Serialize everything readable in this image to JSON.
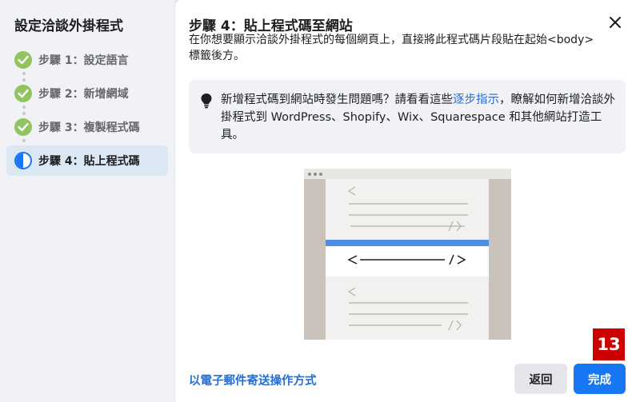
{
  "sidebar": {
    "title": "設定洽談外掛程式",
    "steps": [
      {
        "label": "步驟 1：設定語言",
        "state": "done"
      },
      {
        "label": "步驟 2：新增網域",
        "state": "done"
      },
      {
        "label": "步驟 3：複製程式碼",
        "state": "done"
      },
      {
        "label": "步驟 4：貼上程式碼",
        "state": "current"
      }
    ]
  },
  "main": {
    "title": "步驟 4：貼上程式碼至網站",
    "description": "在你想要顯示洽談外掛程式的每個網頁上，直接將此程式碼片段貼在起始<body>標籤後方。",
    "tip": {
      "icon": "lightbulb-icon",
      "text_before": "新增程式碼到網站時發生問題嗎？請看看這些",
      "link": "逐步指示",
      "text_after": "，瞭解如何新增洽談外掛程式到 WordPress、Shopify、Wix、Squarespace 和其他網站打造工具。"
    }
  },
  "footer": {
    "email_link": "以電子郵件寄送操作方式",
    "back_label": "返回",
    "done_label": "完成"
  },
  "badge": "13",
  "colors": {
    "accent": "#1877f2",
    "link": "#216fdb",
    "done_check": "#8fc45f",
    "badge": "#cc0000"
  }
}
